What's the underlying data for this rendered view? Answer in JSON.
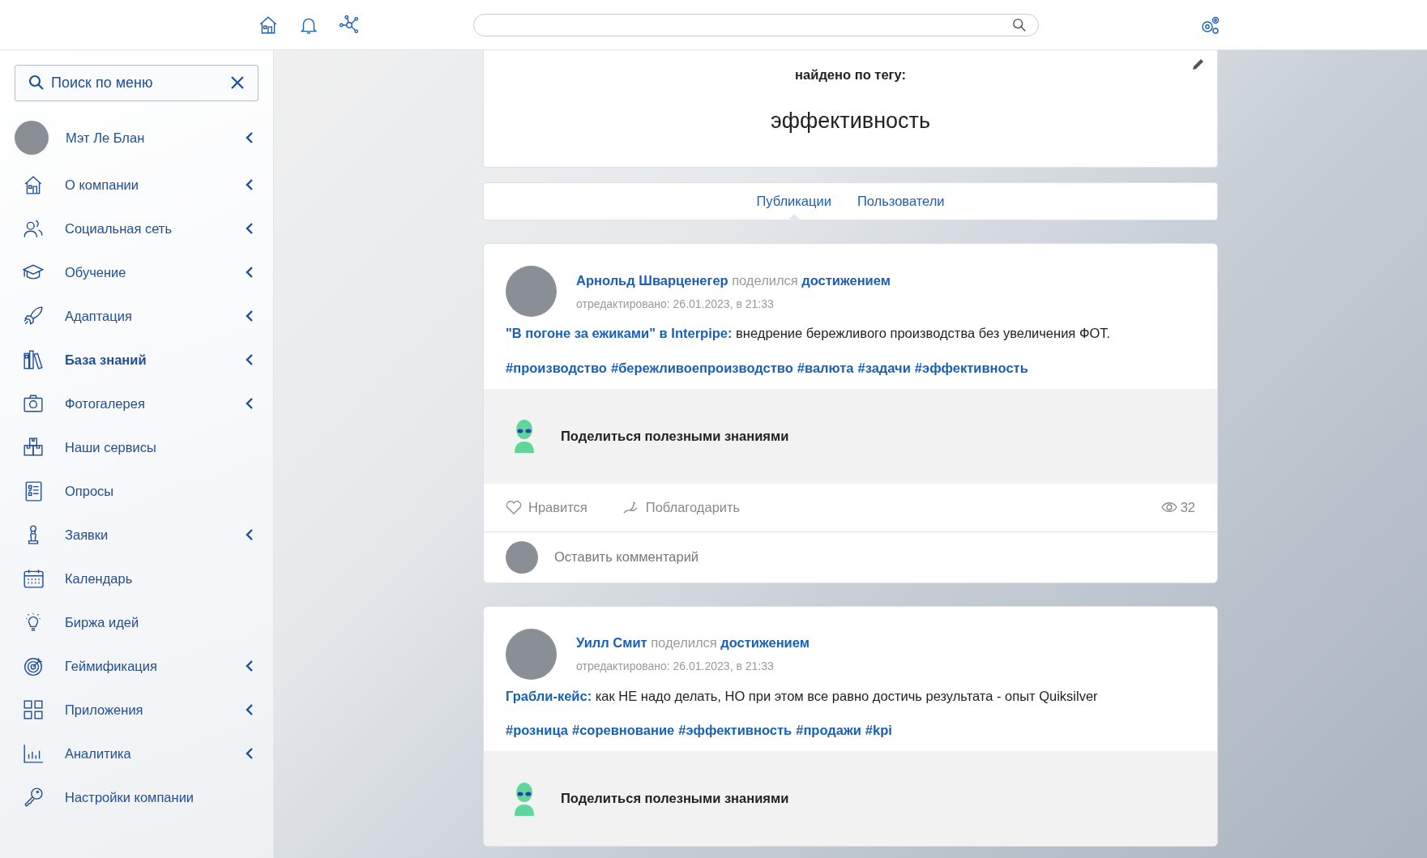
{
  "sidebar": {
    "search": {
      "placeholder": "Поиск по меню"
    },
    "user": {
      "name": "Мэт Ле Блан",
      "expandable": true
    },
    "items": [
      {
        "label": "О компании",
        "expandable": true,
        "selected": false
      },
      {
        "label": "Социальная сеть",
        "expandable": true,
        "selected": false
      },
      {
        "label": "Обучение",
        "expandable": true,
        "selected": false
      },
      {
        "label": "Адаптация",
        "expandable": true,
        "selected": false
      },
      {
        "label": "База знаний",
        "expandable": true,
        "selected": true
      },
      {
        "label": "Фотогалерея",
        "expandable": true,
        "selected": false
      },
      {
        "label": "Наши сервисы",
        "expandable": false,
        "selected": false
      },
      {
        "label": "Опросы",
        "expandable": false,
        "selected": false
      },
      {
        "label": "Заявки",
        "expandable": true,
        "selected": false
      },
      {
        "label": "Календарь",
        "expandable": false,
        "selected": false
      },
      {
        "label": "Биржа идей",
        "expandable": false,
        "selected": false
      },
      {
        "label": "Геймификация",
        "expandable": true,
        "selected": false
      },
      {
        "label": "Приложения",
        "expandable": true,
        "selected": false
      },
      {
        "label": "Аналитика",
        "expandable": true,
        "selected": false
      },
      {
        "label": "Настройки компании",
        "expandable": false,
        "selected": false
      }
    ]
  },
  "tag_header": {
    "label": "найдено по тегу:",
    "tag": "эффективность"
  },
  "tabs": [
    {
      "label": "Публикации",
      "selected": true
    },
    {
      "label": "Пользователи",
      "selected": false
    }
  ],
  "posts": [
    {
      "author": "Арнольд Шварценегер",
      "action": "поделился",
      "object": "достижением",
      "edited": "отредактировано: 26.01.2023, в 21:33",
      "title_link": "\"В погоне за ежиками\" в Interpipe:",
      "text": "внедрение бережливого производства без увеличения ФОТ.",
      "hashtags": [
        "#производство",
        "#бережливоепроизводство",
        "#валюта",
        "#задачи",
        "#эффективность"
      ],
      "share_label": "Поделиться полезными знаниями",
      "like": "Нравится",
      "thank": "Поблагодарить",
      "views": "32",
      "comment_placeholder": "Оставить комментарий"
    },
    {
      "author": "Уилл Смит",
      "action": "поделился",
      "object": "достижением",
      "edited": "отредактировано: 26.01.2023, в 21:33",
      "title_link": "Грабли-кейс:",
      "text": "как НЕ надо делать, НО при этом все равно достичь результата - опыт Quiksilver",
      "hashtags": [
        "#розница",
        "#соревнование",
        "#эффективность",
        "#продажи",
        "#kpi"
      ],
      "share_label": "Поделиться полезными знаниями"
    }
  ]
}
